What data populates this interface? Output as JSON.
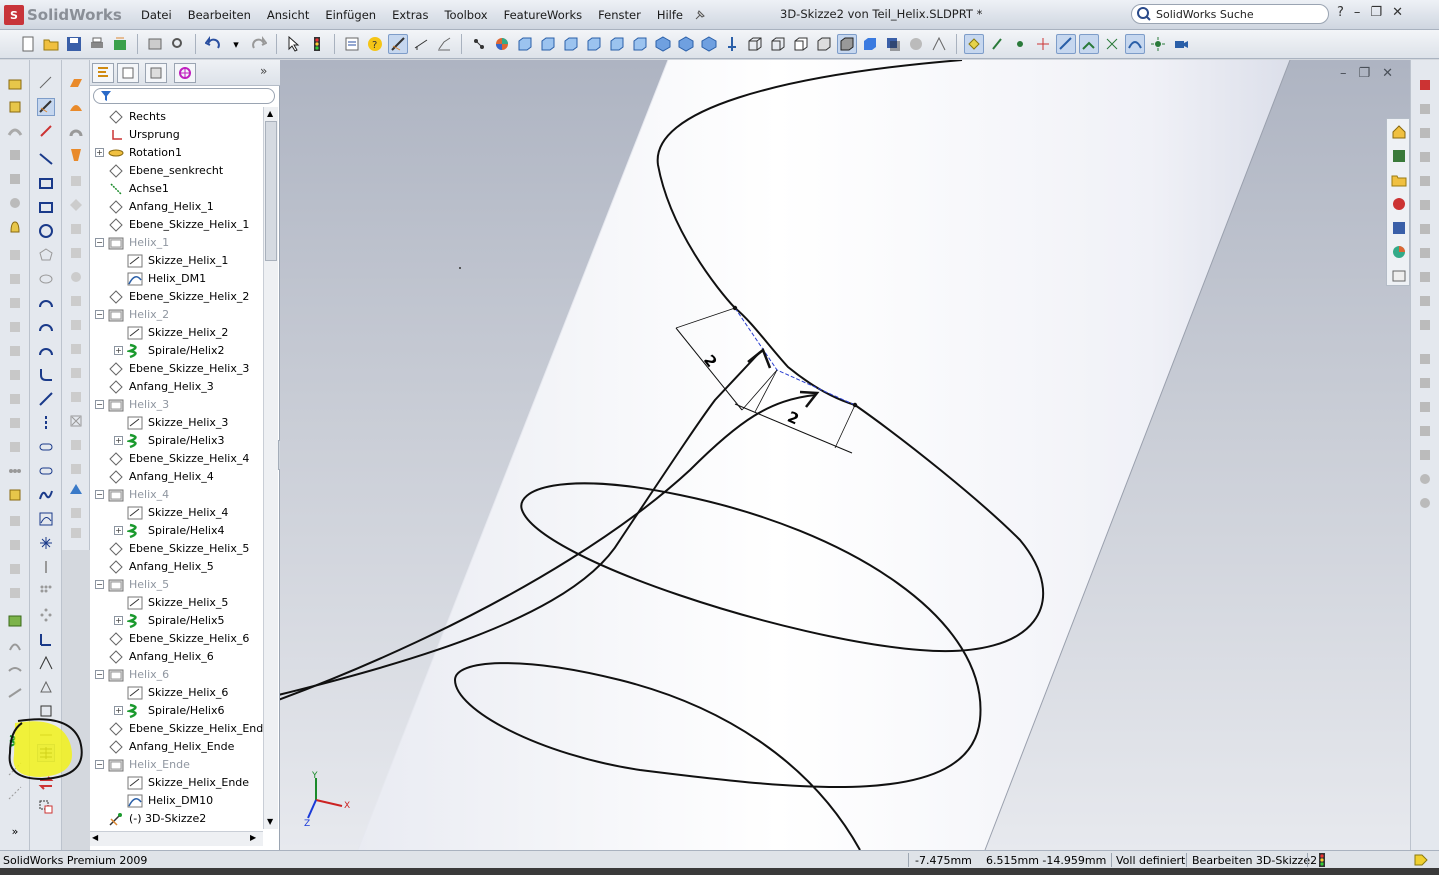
{
  "app": {
    "logo_text": "SolidWorks",
    "document_title": "3D-Skizze2 von Teil_Helix.SLDPRT *"
  },
  "menu": [
    "Datei",
    "Bearbeiten",
    "Ansicht",
    "Einfügen",
    "Extras",
    "Toolbox",
    "FeatureWorks",
    "Fenster",
    "Hilfe"
  ],
  "search": {
    "placeholder": "SolidWorks Suche"
  },
  "window_controls": [
    "?",
    "–",
    "❐",
    "✕"
  ],
  "viewport_controls": [
    "–",
    "❐",
    "✕"
  ],
  "feature_tree": [
    {
      "label": "Rechts",
      "icon": "plane-icon",
      "depth": 0
    },
    {
      "label": "Ursprung",
      "icon": "origin-icon",
      "depth": 0
    },
    {
      "label": "Rotation1",
      "icon": "revolve-icon",
      "depth": 0,
      "expand": "+"
    },
    {
      "label": "Ebene_senkrecht",
      "icon": "plane-icon",
      "depth": 0
    },
    {
      "label": "Achse1",
      "icon": "axis-icon",
      "depth": 0
    },
    {
      "label": "Anfang_Helix_1",
      "icon": "plane-icon",
      "depth": 0
    },
    {
      "label": "Ebene_Skizze_Helix_1",
      "icon": "plane-icon",
      "depth": 0
    },
    {
      "label": "Helix_1",
      "icon": "folder-icon",
      "depth": 0,
      "expand": "–",
      "dim": true
    },
    {
      "label": "Skizze_Helix_1",
      "icon": "sketch-icon",
      "depth": 1
    },
    {
      "label": "Helix_DM1",
      "icon": "curve-icon",
      "depth": 1
    },
    {
      "label": "Ebene_Skizze_Helix_2",
      "icon": "plane-icon",
      "depth": 0
    },
    {
      "label": "Helix_2",
      "icon": "folder-icon",
      "depth": 0,
      "expand": "–",
      "dim": true
    },
    {
      "label": "Skizze_Helix_2",
      "icon": "sketch-icon",
      "depth": 1
    },
    {
      "label": "Spirale/Helix2",
      "icon": "helix-icon",
      "depth": 1,
      "expand": "+"
    },
    {
      "label": "Ebene_Skizze_Helix_3",
      "icon": "plane-icon",
      "depth": 0
    },
    {
      "label": "Anfang_Helix_3",
      "icon": "plane-icon",
      "depth": 0
    },
    {
      "label": "Helix_3",
      "icon": "folder-icon",
      "depth": 0,
      "expand": "–",
      "dim": true
    },
    {
      "label": "Skizze_Helix_3",
      "icon": "sketch-icon",
      "depth": 1
    },
    {
      "label": "Spirale/Helix3",
      "icon": "helix-icon",
      "depth": 1,
      "expand": "+"
    },
    {
      "label": "Ebene_Skizze_Helix_4",
      "icon": "plane-icon",
      "depth": 0
    },
    {
      "label": "Anfang_Helix_4",
      "icon": "plane-icon",
      "depth": 0
    },
    {
      "label": "Helix_4",
      "icon": "folder-icon",
      "depth": 0,
      "expand": "–",
      "dim": true
    },
    {
      "label": "Skizze_Helix_4",
      "icon": "sketch-icon",
      "depth": 1
    },
    {
      "label": "Spirale/Helix4",
      "icon": "helix-icon",
      "depth": 1,
      "expand": "+"
    },
    {
      "label": "Ebene_Skizze_Helix_5",
      "icon": "plane-icon",
      "depth": 0
    },
    {
      "label": "Anfang_Helix_5",
      "icon": "plane-icon",
      "depth": 0
    },
    {
      "label": "Helix_5",
      "icon": "folder-icon",
      "depth": 0,
      "expand": "–",
      "dim": true
    },
    {
      "label": "Skizze_Helix_5",
      "icon": "sketch-icon",
      "depth": 1
    },
    {
      "label": "Spirale/Helix5",
      "icon": "helix-icon",
      "depth": 1,
      "expand": "+"
    },
    {
      "label": "Ebene_Skizze_Helix_6",
      "icon": "plane-icon",
      "depth": 0
    },
    {
      "label": "Anfang_Helix_6",
      "icon": "plane-icon",
      "depth": 0
    },
    {
      "label": "Helix_6",
      "icon": "folder-icon",
      "depth": 0,
      "expand": "–",
      "dim": true
    },
    {
      "label": "Skizze_Helix_6",
      "icon": "sketch-icon",
      "depth": 1
    },
    {
      "label": "Spirale/Helix6",
      "icon": "helix-icon",
      "depth": 1,
      "expand": "+"
    },
    {
      "label": "Ebene_Skizze_Helix_Ende",
      "icon": "plane-icon",
      "depth": 0
    },
    {
      "label": "Anfang_Helix_Ende",
      "icon": "plane-icon",
      "depth": 0
    },
    {
      "label": "Helix_Ende",
      "icon": "folder-icon",
      "depth": 0,
      "expand": "–",
      "dim": true
    },
    {
      "label": "Skizze_Helix_Ende",
      "icon": "sketch-icon",
      "depth": 1
    },
    {
      "label": "Helix_DM10",
      "icon": "curve-icon",
      "depth": 1
    },
    {
      "label": "(-) 3D-Skizze2",
      "icon": "3dsketch-icon",
      "depth": 0
    }
  ],
  "dimensions": [
    "2",
    "2"
  ],
  "triad": {
    "x": "X",
    "y": "Y",
    "z": "Z"
  },
  "status": {
    "product": "SolidWorks Premium 2009",
    "coord_x": "-7.475mm",
    "coord_yz": "6.515mm -14.959mm",
    "definition": "Voll definiert",
    "mode": "Bearbeiten 3D-Skizze2"
  },
  "colors": {
    "highlight": "#f2f21a",
    "sketch_line": "#1a1a1a",
    "construction": "#2a3fd0",
    "helix_green": "#1b9a2e"
  }
}
